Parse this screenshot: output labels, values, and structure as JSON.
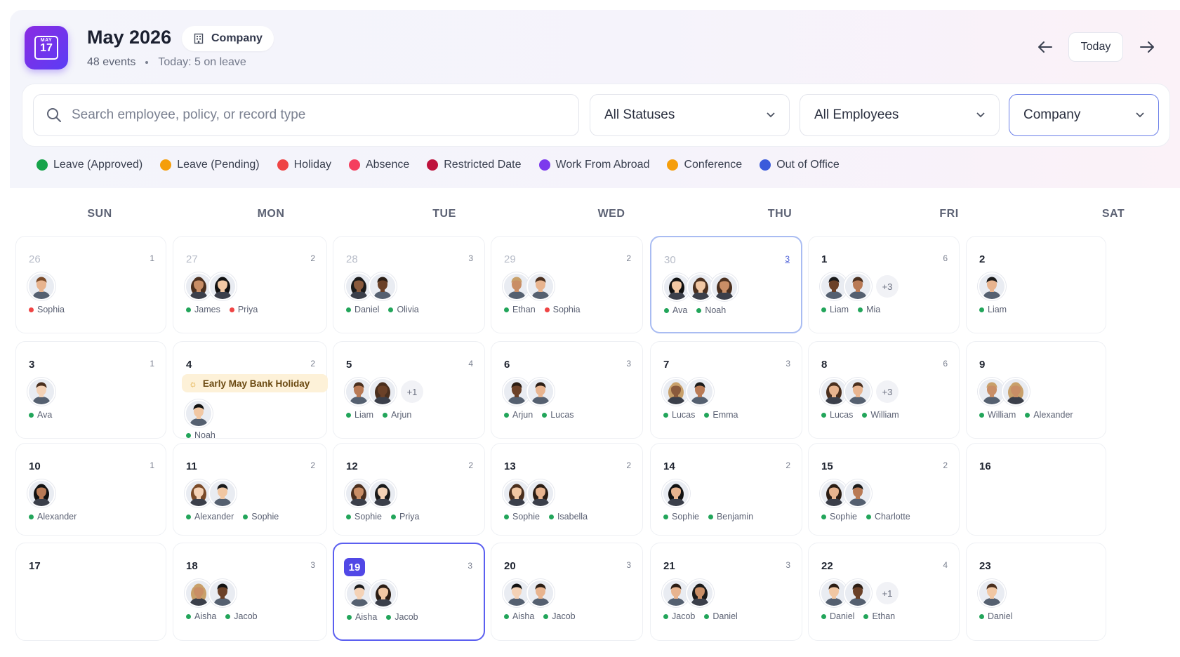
{
  "header": {
    "icon_month": "MAY",
    "icon_day": "17",
    "title": "May 2026",
    "scope_chip": "Company",
    "event_count": "48 events",
    "today_summary": "Today: 5 on leave",
    "today_button": "Today"
  },
  "filters": {
    "search_placeholder": "Search employee, policy, or record type",
    "status": "All Statuses",
    "employees": "All Employees",
    "scope": "Company"
  },
  "legend": [
    {
      "label": "Leave (Approved)",
      "color": "#16a34a"
    },
    {
      "label": "Leave (Pending)",
      "color": "#f59e0b"
    },
    {
      "label": "Holiday",
      "color": "#ef4444"
    },
    {
      "label": "Absence",
      "color": "#f43f5e"
    },
    {
      "label": "Restricted Date",
      "color": "#be123c"
    },
    {
      "label": "Work From Abroad",
      "color": "#7c3aed"
    },
    {
      "label": "Conference",
      "color": "#f59e0b"
    },
    {
      "label": "Out of Office",
      "color": "#3b5bdb"
    }
  ],
  "weekdays": [
    "SUN",
    "MON",
    "TUE",
    "WED",
    "THU",
    "FRI",
    "SAT"
  ],
  "colors": {
    "approved": "#22a55a",
    "holiday": "#ef4444",
    "accent": "#5148e6"
  },
  "weeks": [
    [
      {
        "day": "26",
        "count": "1",
        "out": true,
        "avatars": 1,
        "names": [
          [
            "Sophia",
            "holiday"
          ]
        ]
      },
      {
        "day": "27",
        "count": "2",
        "out": true,
        "avatars": 2,
        "names": [
          [
            "James",
            "approved"
          ],
          [
            "Priya",
            "holiday"
          ]
        ]
      },
      {
        "day": "28",
        "count": "3",
        "out": true,
        "avatars": 2,
        "names": [
          [
            "Daniel",
            "approved"
          ],
          [
            "Olivia",
            "approved"
          ]
        ]
      },
      {
        "day": "29",
        "count": "2",
        "out": true,
        "avatars": 2,
        "names": [
          [
            "Ethan",
            "approved"
          ],
          [
            "Sophia",
            "holiday"
          ]
        ]
      },
      {
        "day": "30",
        "count": "3",
        "out": true,
        "selected": true,
        "avatars": 3,
        "names": [
          [
            "Ava",
            "approved"
          ],
          [
            "Noah",
            "approved"
          ]
        ]
      },
      {
        "day": "1",
        "count": "6",
        "avatars": 2,
        "more": "+3",
        "names": [
          [
            "Liam",
            "approved"
          ],
          [
            "Mia",
            "approved"
          ]
        ]
      },
      {
        "day": "2",
        "count": "",
        "avatars": 1,
        "names": [
          [
            "Liam",
            "approved"
          ]
        ]
      }
    ],
    [
      {
        "day": "3",
        "count": "1",
        "avatars": 1,
        "names": [
          [
            "Ava",
            "approved"
          ]
        ]
      },
      {
        "day": "4",
        "count": "2",
        "holiday": "Early May Bank Holiday",
        "avatars": 1,
        "names": [
          [
            "Noah",
            "approved"
          ]
        ]
      },
      {
        "day": "5",
        "count": "4",
        "avatars": 2,
        "more": "+1",
        "names": [
          [
            "Liam",
            "approved"
          ],
          [
            "Arjun",
            "approved"
          ]
        ]
      },
      {
        "day": "6",
        "count": "3",
        "avatars": 2,
        "names": [
          [
            "Arjun",
            "approved"
          ],
          [
            "Lucas",
            "approved"
          ]
        ]
      },
      {
        "day": "7",
        "count": "3",
        "avatars": 2,
        "names": [
          [
            "Lucas",
            "approved"
          ],
          [
            "Emma",
            "approved"
          ]
        ]
      },
      {
        "day": "8",
        "count": "6",
        "avatars": 2,
        "more": "+3",
        "names": [
          [
            "Lucas",
            "approved"
          ],
          [
            "William",
            "approved"
          ]
        ]
      },
      {
        "day": "9",
        "count": "",
        "avatars": 2,
        "names": [
          [
            "William",
            "approved"
          ],
          [
            "Alexander",
            "approved"
          ]
        ]
      }
    ],
    [
      {
        "day": "10",
        "count": "1",
        "avatars": 1,
        "names": [
          [
            "Alexander",
            "approved"
          ]
        ]
      },
      {
        "day": "11",
        "count": "2",
        "avatars": 2,
        "names": [
          [
            "Alexander",
            "approved"
          ],
          [
            "Sophie",
            "approved"
          ]
        ]
      },
      {
        "day": "12",
        "count": "2",
        "avatars": 2,
        "names": [
          [
            "Sophie",
            "approved"
          ],
          [
            "Priya",
            "approved"
          ]
        ]
      },
      {
        "day": "13",
        "count": "2",
        "avatars": 2,
        "names": [
          [
            "Sophie",
            "approved"
          ],
          [
            "Isabella",
            "approved"
          ]
        ]
      },
      {
        "day": "14",
        "count": "2",
        "avatars": 1,
        "names": [
          [
            "Sophie",
            "approved"
          ],
          [
            "Benjamin",
            "approved"
          ]
        ]
      },
      {
        "day": "15",
        "count": "2",
        "avatars": 2,
        "names": [
          [
            "Sophie",
            "approved"
          ],
          [
            "Charlotte",
            "approved"
          ]
        ]
      },
      {
        "day": "16",
        "count": "",
        "avatars": 0,
        "names": []
      }
    ],
    [
      {
        "day": "17",
        "count": "",
        "avatars": 0,
        "names": []
      },
      {
        "day": "18",
        "count": "3",
        "avatars": 2,
        "names": [
          [
            "Aisha",
            "approved"
          ],
          [
            "Jacob",
            "approved"
          ]
        ]
      },
      {
        "day": "19",
        "count": "3",
        "today": true,
        "avatars": 2,
        "names": [
          [
            "Aisha",
            "approved"
          ],
          [
            "Jacob",
            "approved"
          ]
        ]
      },
      {
        "day": "20",
        "count": "3",
        "avatars": 2,
        "names": [
          [
            "Aisha",
            "approved"
          ],
          [
            "Jacob",
            "approved"
          ]
        ]
      },
      {
        "day": "21",
        "count": "3",
        "avatars": 2,
        "names": [
          [
            "Jacob",
            "approved"
          ],
          [
            "Daniel",
            "approved"
          ]
        ]
      },
      {
        "day": "22",
        "count": "4",
        "avatars": 2,
        "more": "+1",
        "names": [
          [
            "Daniel",
            "approved"
          ],
          [
            "Ethan",
            "approved"
          ]
        ]
      },
      {
        "day": "23",
        "count": "",
        "avatars": 1,
        "names": [
          [
            "Daniel",
            "approved"
          ]
        ]
      }
    ]
  ]
}
